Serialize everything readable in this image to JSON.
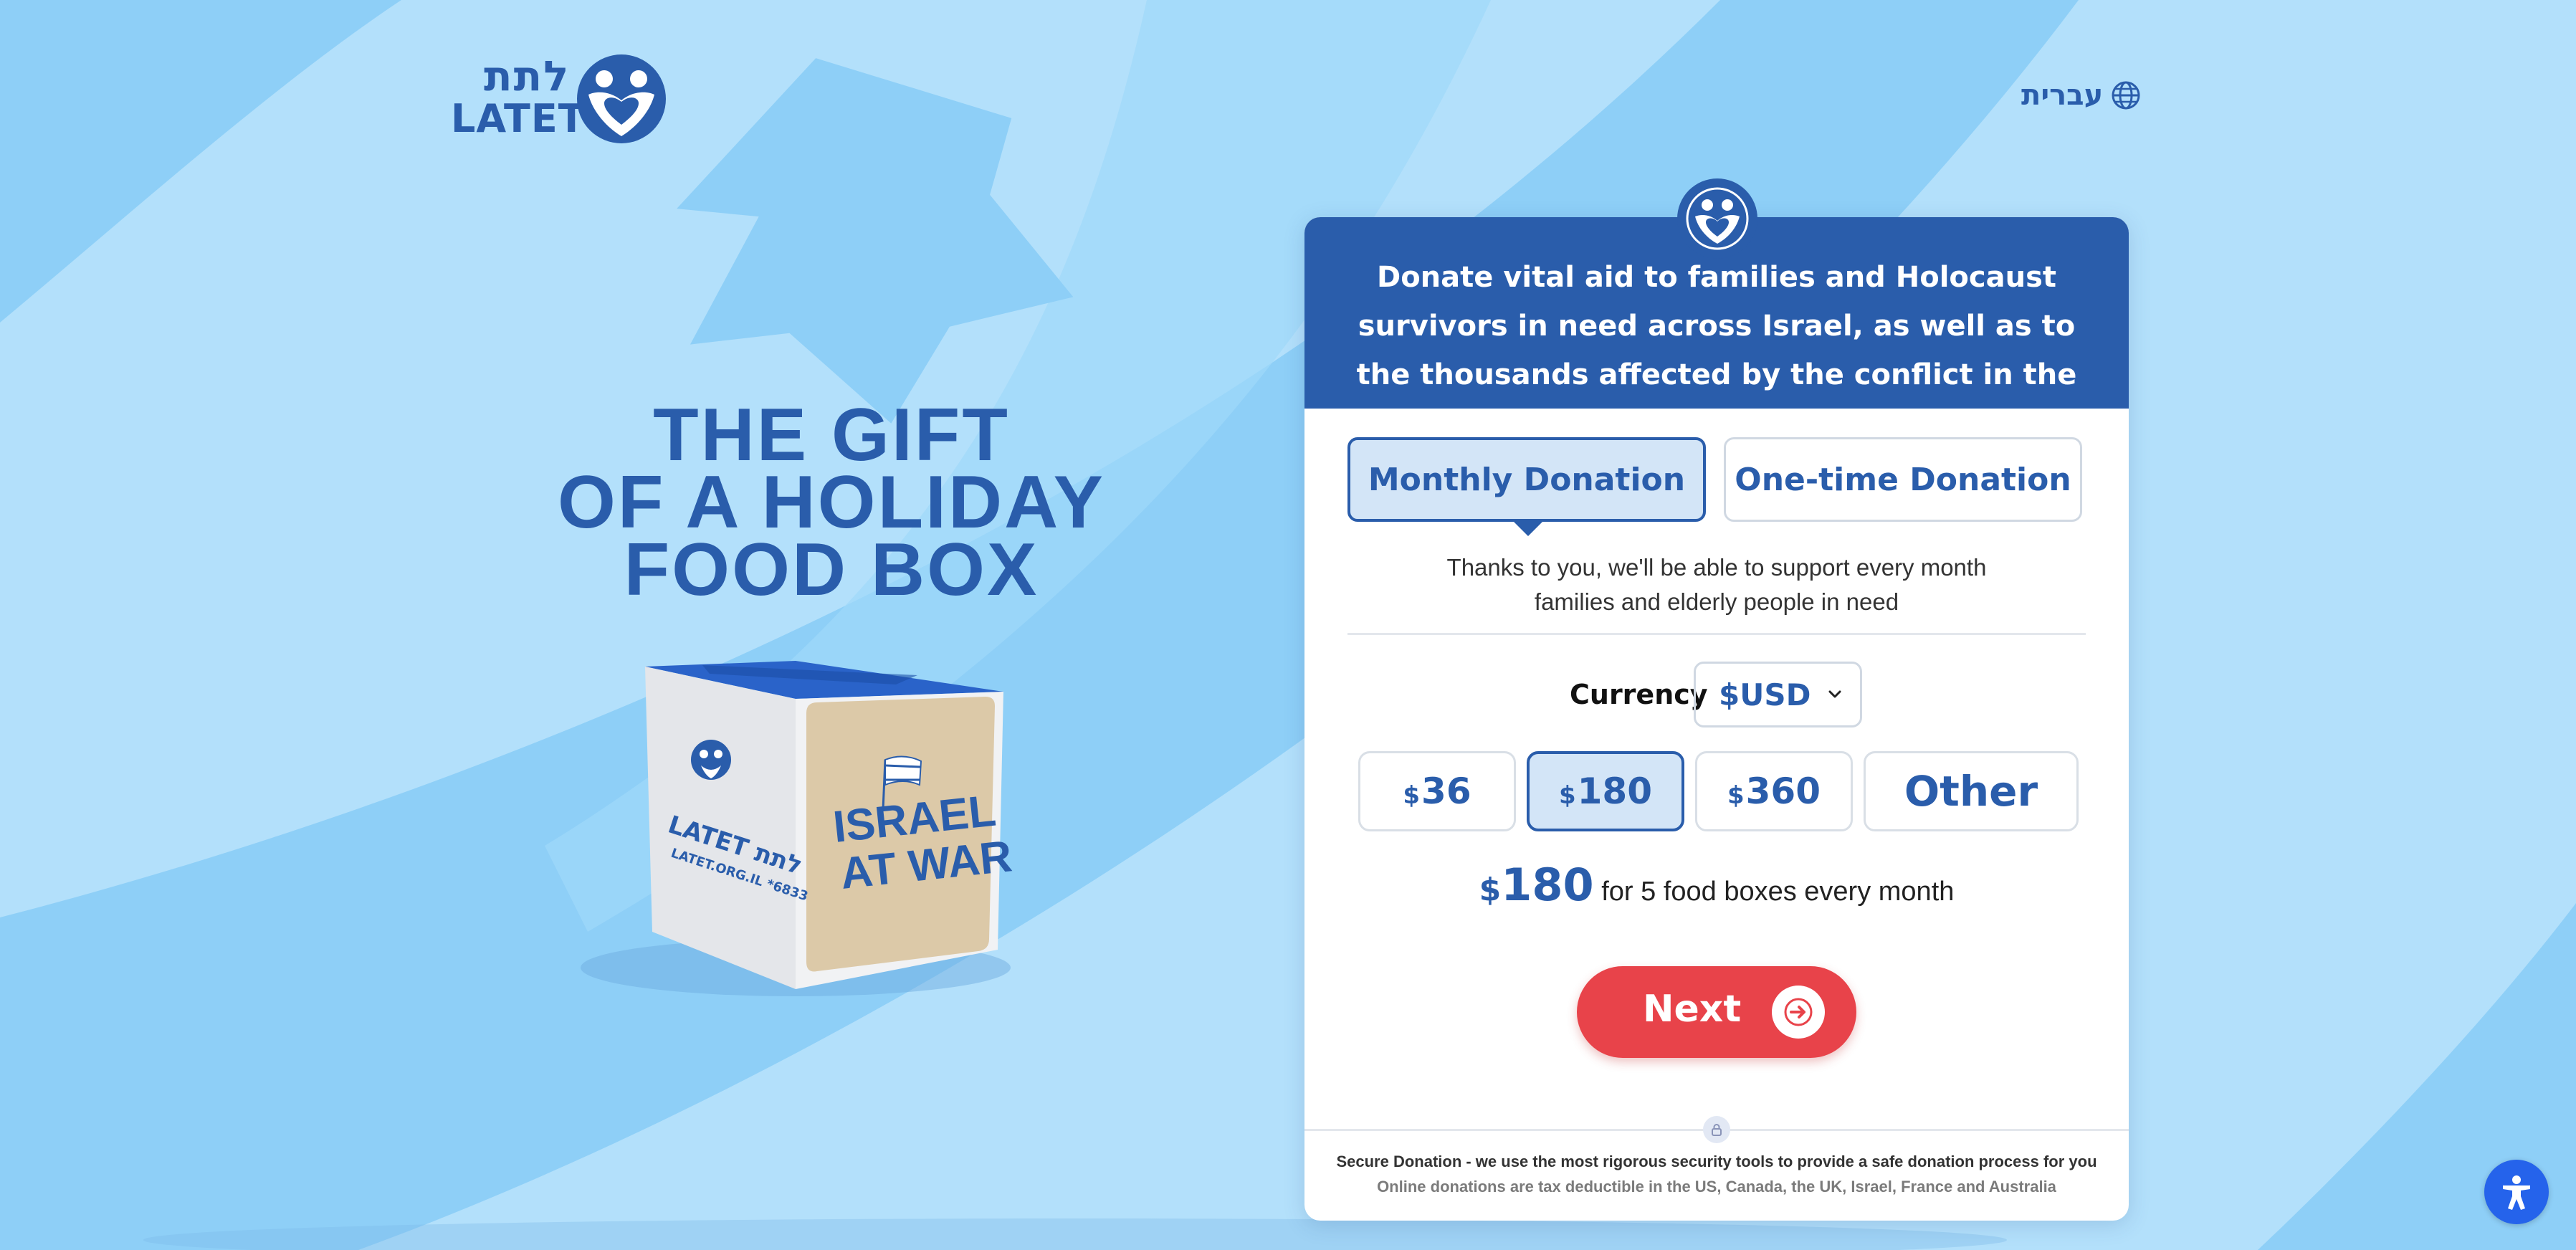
{
  "brand": {
    "hebrew": "לתת",
    "latin": "LATET"
  },
  "language": {
    "label": "עברית",
    "icon": "globe-icon"
  },
  "headline": {
    "line1": "THE GIFT",
    "line2": "OF A HOLIDAY",
    "line3": "FOOD BOX"
  },
  "box": {
    "logo_name": "LATET לתת",
    "url": "LATET.ORG.IL *6833",
    "slogan_line1": "ISRAEL",
    "slogan_line2": "AT WAR"
  },
  "card": {
    "header_text": "Donate vital aid to families and Holocaust survivors in need across Israel, as well as to the thousands affected by the conflict in the North",
    "tabs": {
      "monthly": "Monthly Donation",
      "one_time": "One-time Donation",
      "selected": "monthly"
    },
    "description_line1": "Thanks to you, we'll be able to support every month",
    "description_line2": "families and elderly people in need",
    "currency": {
      "label": "Currency",
      "value": "$USD",
      "icon": "chevron-down-icon"
    },
    "amounts": [
      {
        "currency": "$",
        "value": "36"
      },
      {
        "currency": "$",
        "value": "180"
      },
      {
        "currency": "$",
        "value": "360"
      },
      {
        "currency": "",
        "value": "Other"
      }
    ],
    "selected_amount_index": 1,
    "summary": {
      "currency": "$",
      "amount": "180",
      "text": "for 5 food boxes every month"
    },
    "next_label": "Next",
    "secure_text": "Secure Donation - we use the most rigorous security tools to provide a safe donation process for you",
    "tax_text": "Online donations are tax deductible in the US, Canada, the UK, Israel, France and Australia"
  },
  "accessibility": {
    "icon": "accessibility-icon"
  },
  "colors": {
    "brand_blue": "#2a5dab",
    "light_bg": "#b3e0fb",
    "cta_red": "#e8434a",
    "selected_fill": "#d3e5f7"
  }
}
